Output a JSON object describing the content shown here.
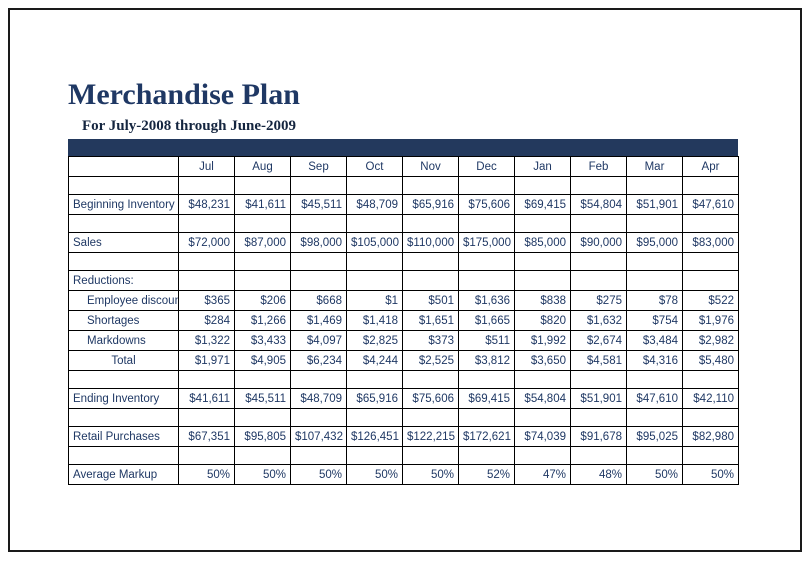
{
  "document": {
    "title": "Merchandise Plan",
    "subtitle": "For July-2008 through June-2009"
  },
  "colors": {
    "navy_band": "#23395D",
    "title_text": "#1F3864",
    "label_fill": "#D9D9D9",
    "value_text": "#1F3864",
    "page_border": "#1a1a1a"
  },
  "table": {
    "corner_header": "",
    "months": [
      "Jul",
      "Aug",
      "Sep",
      "Oct",
      "Nov",
      "Dec",
      "Jan",
      "Feb",
      "Mar",
      "Apr"
    ],
    "rows": [
      {
        "label": "Beginning Inventory",
        "style": "normal",
        "values": [
          "$48,231",
          "$41,611",
          "$45,511",
          "$48,709",
          "$65,916",
          "$75,606",
          "$69,415",
          "$54,804",
          "$51,901",
          "$47,610"
        ]
      },
      {
        "label": "Sales",
        "style": "normal",
        "values": [
          "$72,000",
          "$87,000",
          "$98,000",
          "$105,000",
          "$110,000",
          "$175,000",
          "$85,000",
          "$90,000",
          "$95,000",
          "$83,000"
        ]
      },
      {
        "label": "Reductions:",
        "style": "section",
        "values": [
          "",
          "",
          "",
          "",
          "",
          "",
          "",
          "",
          "",
          ""
        ]
      },
      {
        "label": "Employee discoun",
        "style": "indent",
        "values": [
          "$365",
          "$206",
          "$668",
          "$1",
          "$501",
          "$1,636",
          "$838",
          "$275",
          "$78",
          "$522"
        ]
      },
      {
        "label": "Shortages",
        "style": "indent",
        "values": [
          "$284",
          "$1,266",
          "$1,469",
          "$1,418",
          "$1,651",
          "$1,665",
          "$820",
          "$1,632",
          "$754",
          "$1,976"
        ]
      },
      {
        "label": "Markdowns",
        "style": "indent",
        "values": [
          "$1,322",
          "$3,433",
          "$4,097",
          "$2,825",
          "$373",
          "$511",
          "$1,992",
          "$2,674",
          "$3,484",
          "$2,982"
        ]
      },
      {
        "label": "Total",
        "style": "center",
        "values": [
          "$1,971",
          "$4,905",
          "$6,234",
          "$4,244",
          "$2,525",
          "$3,812",
          "$3,650",
          "$4,581",
          "$4,316",
          "$5,480"
        ]
      },
      {
        "label": "Ending Inventory",
        "style": "normal",
        "values": [
          "$41,611",
          "$45,511",
          "$48,709",
          "$65,916",
          "$75,606",
          "$69,415",
          "$54,804",
          "$51,901",
          "$47,610",
          "$42,110"
        ]
      },
      {
        "label": "Retail Purchases",
        "style": "normal",
        "values": [
          "$67,351",
          "$95,805",
          "$107,432",
          "$126,451",
          "$122,215",
          "$172,621",
          "$74,039",
          "$91,678",
          "$95,025",
          "$82,980"
        ]
      },
      {
        "label": "Average Markup",
        "style": "normal",
        "values": [
          "50%",
          "50%",
          "50%",
          "50%",
          "50%",
          "52%",
          "47%",
          "48%",
          "50%",
          "50%"
        ]
      }
    ],
    "layout": {
      "spacer_before": [
        "Beginning Inventory",
        "Sales",
        "Reductions:",
        "Ending Inventory",
        "Retail Purchases",
        "Average Markup"
      ]
    }
  }
}
